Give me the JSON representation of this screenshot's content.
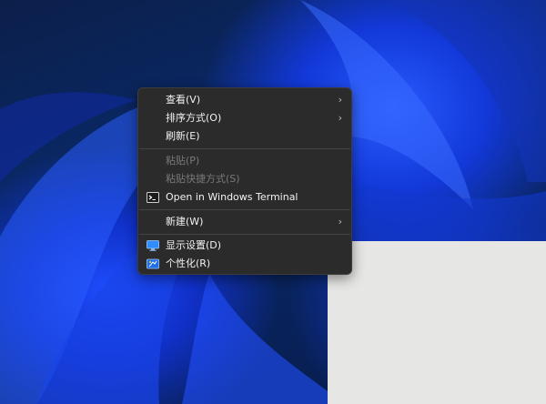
{
  "context_menu": {
    "items": [
      {
        "label": "查看(V)",
        "submenu": true,
        "enabled": true
      },
      {
        "label": "排序方式(O)",
        "submenu": true,
        "enabled": true
      },
      {
        "label": "刷新(E)",
        "submenu": false,
        "enabled": true
      },
      {
        "label": "粘贴(P)",
        "submenu": false,
        "enabled": false
      },
      {
        "label": "粘贴快捷方式(S)",
        "submenu": false,
        "enabled": false
      },
      {
        "label": "Open in Windows Terminal",
        "submenu": false,
        "enabled": true,
        "icon": "terminal-icon"
      },
      {
        "label": "新建(W)",
        "submenu": true,
        "enabled": true
      },
      {
        "label": "显示设置(D)",
        "submenu": false,
        "enabled": true,
        "icon": "display-settings-icon"
      },
      {
        "label": "个性化(R)",
        "submenu": false,
        "enabled": true,
        "icon": "personalize-icon"
      }
    ],
    "chevron_glyph": "›"
  },
  "colors": {
    "menu_bg": "#2b2b2b",
    "text": "#f2f2f2",
    "disabled_text": "#7a7a7a",
    "accent_icon": "#2f8cff"
  }
}
